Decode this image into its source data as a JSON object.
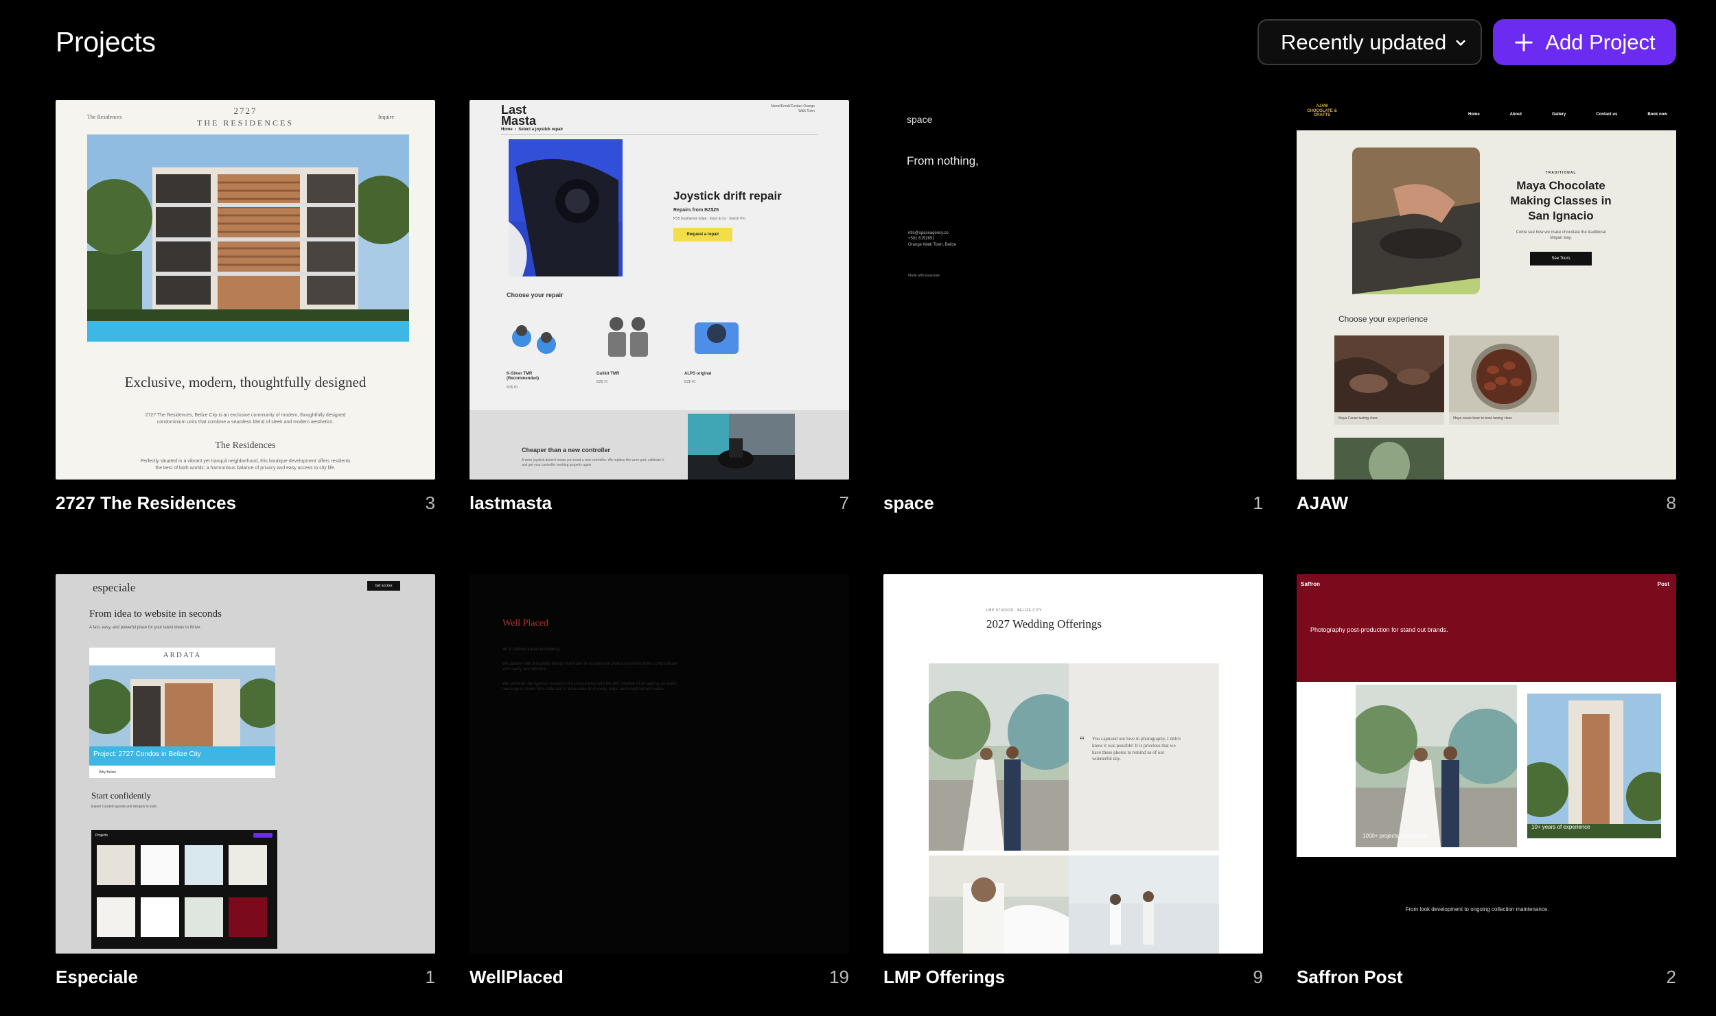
{
  "header": {
    "title": "Projects",
    "sort_label": "Recently updated",
    "add_label": "Add Project"
  },
  "projects": [
    {
      "name": "2727 The Residences",
      "count": "3",
      "thumb": {
        "nav_left": "The Residences",
        "logo_top": "2727",
        "logo_bottom": "RESIDENCES",
        "logo_the": "THE",
        "nav_right": "Inquire",
        "headline": "Exclusive, modern, thoughtfully designed",
        "body": "2727 The Residences, Belize City is an exclusive community of modern, thoughtfully designed condominium units that combine a seamless blend of sleek and modern aesthetics.",
        "subhead": "The Residences",
        "body2": "Perfectly situated in a vibrant yet tranquil neighborhood, this boutique development offers residents the best of both worlds: a harmonious balance of privacy and easy access to city life."
      }
    },
    {
      "name": "lastmasta",
      "count": "7",
      "thumb": {
        "logo": "Last Masta",
        "crumb_home": "Home",
        "crumb_page": "Select a joystick repair",
        "contact": "Name/Email/Contact Orange Walk Town",
        "heading": "Joystick drift repair",
        "price": "Repairs from BZ$25",
        "sub": "PS5 DualSense Edge · Xbox & Co · Switch Pro",
        "cta": "Request a repair",
        "choose": "Choose your repair",
        "options": [
          {
            "name": "K-Silver TMR (Recommended)",
            "price": "BZ$ 80"
          },
          {
            "name": "Gulikit TMR",
            "price": "BZ$ 70"
          },
          {
            "name": "ALPS original",
            "price": "BZ$ 40"
          }
        ],
        "banner_title": "Cheaper than a new controller",
        "banner_body": "A worn joystick doesn't mean you need a new controller. We replace the worn part, calibrate it, and get your controller working properly again"
      }
    },
    {
      "name": "space",
      "count": "1",
      "thumb": {
        "logo": "space",
        "tagline": "From nothing,",
        "email": "info@spaceagency.co",
        "phone": "+501 6152651",
        "location": "Orange Walk Town, Belize",
        "made": "Made with Especiale"
      }
    },
    {
      "name": "AJAW",
      "count": "8",
      "thumb": {
        "logo": "AJAW CHOCOLATE & CRAFTS",
        "nav": [
          "Home",
          "About",
          "Gallery",
          "Contact us",
          "Book now"
        ],
        "kicker": "TRADITIONAL",
        "heading": "Maya Chocolate Making Classes in San Ignacio",
        "body": "Come see how we make chocolate the traditional Mayan way.",
        "cta": "See Tours",
        "choose": "Choose your experience",
        "exp1": "Maya Cacao tasting class",
        "exp2": "Maya cacao bean to bowl tasting class"
      }
    },
    {
      "name": "Especiale",
      "count": "1",
      "thumb": {
        "logo": "especiale",
        "btn": "Get access",
        "heading": "From idea to website in seconds",
        "sub": "A fast, easy, and powerful place for your latest ideas to thrive.",
        "preview_logo": "ARDATA",
        "preview_caption": "Project: 2727 Condos in Belize City",
        "preview_small": "Why Belize",
        "start": "Start confidently",
        "start_sub": "Expert curated layouts and designs to start.",
        "mini_title": "Projects"
      }
    },
    {
      "name": "WellPlaced",
      "count": "19",
      "thumb": {
        "logo": "Well Placed",
        "line1": "Art & culture brand consultancy",
        "line2": "We partner with thoughtful brands that have an exceptional product and help them communicate with clarity and intention.",
        "line3": "We combine the rigorous research of a consultancy with the deft creative of an agency so every message is drawn from data and is accessible from every angle and weighted with value."
      }
    },
    {
      "name": "LMP Offerings",
      "count": "9",
      "thumb": {
        "kicker": "LMP STUDIOS · BELIZE CITY",
        "heading": "2027 Wedding Offerings",
        "quote": "You captured our love in photography, I didn't know it was possible! It is priceless that we have these photos to remind us of our wonderful day."
      }
    },
    {
      "name": "Saffron Post",
      "count": "2",
      "thumb": {
        "logo": "Saffron",
        "nav": "Post",
        "tagline": "Photography post-production for stand out brands.",
        "stat1": "1000+ projects completed",
        "stat2": "10+ years of experience",
        "footer": "From look development to ongoing collection maintenance."
      }
    }
  ],
  "colors": {
    "accent": "#6c2bf0",
    "saffron": "#7a0a1c",
    "ajaw_bg": "#ecebe4",
    "residences_bg": "#f6f4ee",
    "especiale_bg": "#d4d4d4"
  },
  "icons": {
    "sort": "chevron-down-icon",
    "add": "plus-icon"
  }
}
